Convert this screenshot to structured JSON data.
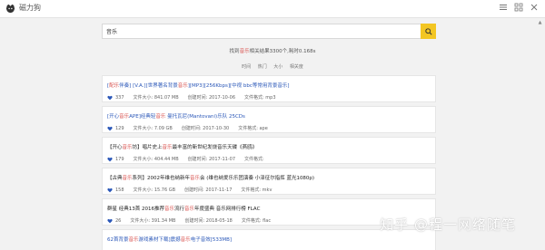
{
  "brand": {
    "name": "磁力狗"
  },
  "search": {
    "value": "音乐"
  },
  "summary": {
    "prefix": "找到",
    "keyword": "音乐",
    "suffix": "相关结果3300个,耗时0.168s"
  },
  "sort": [
    "时间",
    "热门",
    "大小",
    "相关度"
  ],
  "labels": {
    "size": "文件大小:",
    "created": "创建时间:",
    "format": "文件格式:"
  },
  "results": [
    {
      "title_pre": "[",
      "title_hl": "配乐",
      "title_mid": "伴奏] [V.A.][世界著名背景",
      "title_hl2": "音乐",
      "title_post": "][MP3][256Kbps][中视 bbc等常用背景音乐]",
      "count": "337",
      "size": "841.07 MB",
      "created": "2017-10-06",
      "format": "mp3"
    },
    {
      "title_pre": "[开心",
      "title_hl": "音乐",
      "title_mid": "APE]经典轻",
      "title_hl2": "音乐",
      "title_post": " 曼托瓦尼(Mantovani)乐队 25CDs",
      "count": "129",
      "size": "7.09 GB",
      "created": "2017-10-30",
      "format": "ape"
    },
    {
      "title_pre": "【开心",
      "title_hl": "音乐",
      "title_mid": "坊】唱片史上",
      "title_hl2": "音乐",
      "title_post": "最丰富的新世纪发烧音乐天碟《燕鸥》",
      "count": "179",
      "size": "404.44 MB",
      "created": "2017-11-07",
      "format": "",
      "dark": true
    },
    {
      "title_pre": "【古典",
      "title_hl": "音乐",
      "title_mid": "系列】2002年维也纳新年",
      "title_hl2": "音乐",
      "title_post": "会 (维也纳爱乐乐团演奏 小泽征尔指挥 蓝光1080p)",
      "count": "158",
      "size": "15.76 GB",
      "created": "2017-11-17",
      "format": "mkv",
      "dark": true
    },
    {
      "title_pre": "群星 经典13首 2016推荐",
      "title_hl": "音乐",
      "title_mid": "流行",
      "title_hl2": "音乐",
      "title_post": "年度盛典 音乐网排行榜 FLAC",
      "count": "26",
      "size": "391.34 MB",
      "created": "2018-05-18",
      "format": "flac",
      "dark": true
    },
    {
      "title_pre": "62首背景",
      "title_hl": "音乐",
      "title_mid": "游戏素材下载]震撼",
      "title_hl2": "音乐",
      "title_post": "电子音效[533MB]",
      "count": "",
      "size": "",
      "created": "",
      "format": ""
    }
  ],
  "watermark": "知乎 @程一网络随笔"
}
